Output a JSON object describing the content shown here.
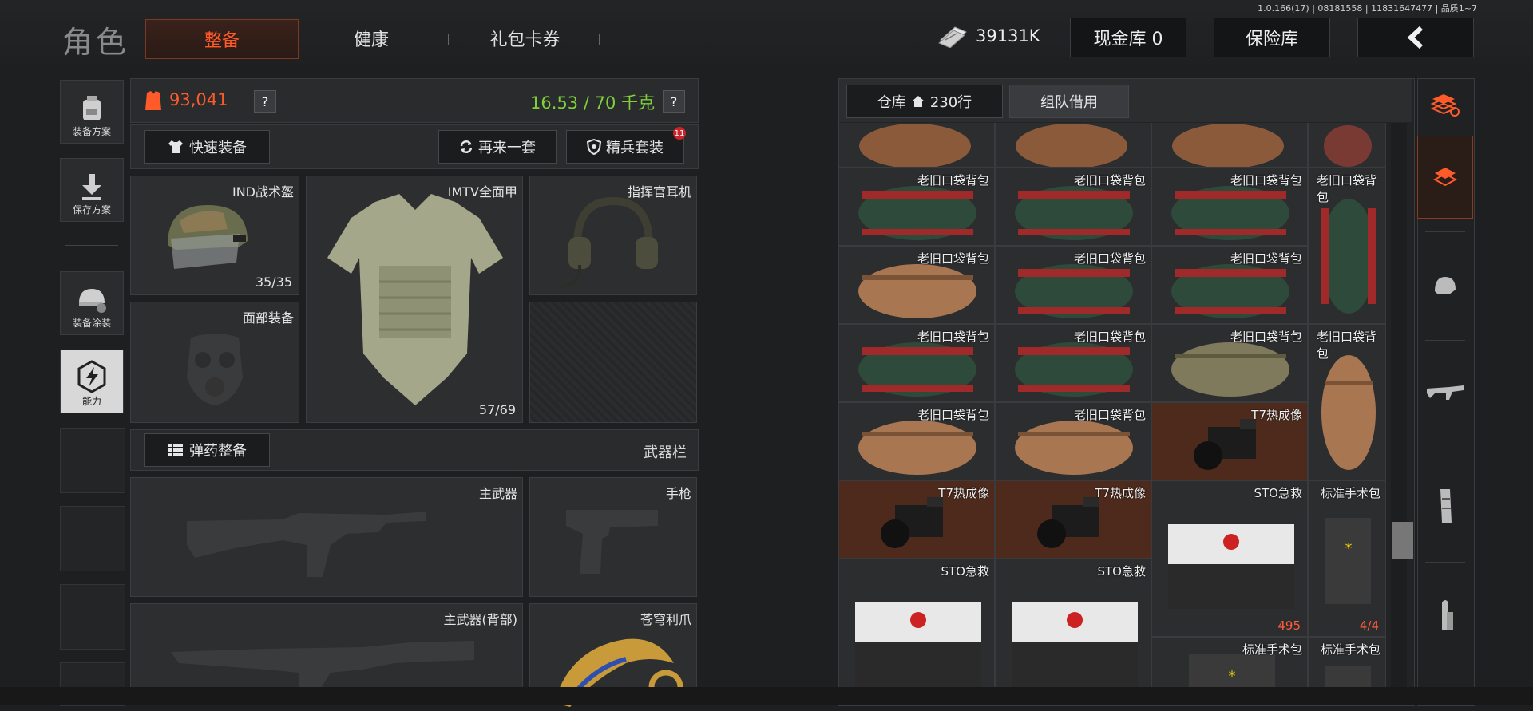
{
  "version": "1.0.166(17) | 08181558 | 11831647477 | 品质1~7",
  "header": {
    "title": "角色",
    "tabs": [
      "整备",
      "健康",
      "礼包卡券"
    ],
    "currency": "39131K",
    "cash_vault": "现金库 0",
    "safe_vault": "保险库",
    "back_icon": "chevron-left-icon"
  },
  "left_sidebar": {
    "items": [
      {
        "label": "装备方案",
        "icon": "backpack-icon"
      },
      {
        "label": "保存方案",
        "icon": "download-icon"
      },
      {
        "label": "装备涂装",
        "icon": "helmet-paint-icon"
      },
      {
        "label": "能力",
        "icon": "lightning-gear-icon"
      }
    ]
  },
  "loadout": {
    "value": "93,041",
    "weight": "16.53 / 70 千克",
    "help": "?",
    "quick_equip": "快速装备",
    "again": "再来一套",
    "elite": "精兵套装",
    "elite_badge": "11",
    "helmet": {
      "name": "IND战术盔",
      "count": "35/35"
    },
    "armor": {
      "name": "IMTV全面甲",
      "count": "57/69"
    },
    "headset": {
      "name": "指挥官耳机"
    },
    "face": {
      "name": "面部装备"
    },
    "ammo_button": "弹药整备",
    "weapon_bar": "武器栏",
    "primary": "主武器",
    "pistol": "手枪",
    "primary_back": "主武器(背部)",
    "melee": "苍穹利爪"
  },
  "storage": {
    "tab_warehouse": "仓库",
    "warehouse_rows": "230行",
    "tab_team": "组队借用",
    "items": {
      "bag": "老旧口袋背包",
      "thermal": "T7热成像",
      "medkit": "STO急救",
      "surgical": "标准手术包",
      "medkit_count": "495",
      "surgical_count": "4/4"
    }
  },
  "colors": {
    "accent": "#ff5a2a",
    "weight_green": "#7fd13a",
    "item_highlight": "#4d2a1c"
  }
}
